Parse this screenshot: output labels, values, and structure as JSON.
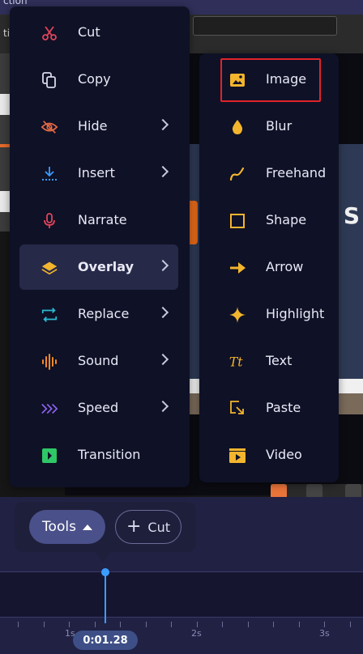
{
  "header": {
    "title_fragment": "ction"
  },
  "editor": {
    "strip_text": "ti"
  },
  "main_menu": {
    "items": [
      {
        "label": "Cut",
        "icon": "scissors-icon",
        "has_submenu": false,
        "color": "#e0445a"
      },
      {
        "label": "Copy",
        "icon": "copy-icon",
        "has_submenu": false,
        "color": "#d8d8e8"
      },
      {
        "label": "Hide",
        "icon": "eye-off-icon",
        "has_submenu": true,
        "color": "#e86a45"
      },
      {
        "label": "Insert",
        "icon": "insert-icon",
        "has_submenu": true,
        "color": "#3b9cff"
      },
      {
        "label": "Narrate",
        "icon": "microphone-icon",
        "has_submenu": false,
        "color": "#e0445a"
      },
      {
        "label": "Overlay",
        "icon": "layers-icon",
        "has_submenu": true,
        "active": true,
        "color": "#f3b52d"
      },
      {
        "label": "Replace",
        "icon": "replace-icon",
        "has_submenu": true,
        "color": "#2bbcd4"
      },
      {
        "label": "Sound",
        "icon": "sound-wave-icon",
        "has_submenu": true,
        "color": "#f08a2a"
      },
      {
        "label": "Speed",
        "icon": "speed-icon",
        "has_submenu": true,
        "color": "#8d63f0"
      },
      {
        "label": "Transition",
        "icon": "transition-icon",
        "has_submenu": false,
        "color": "#2ec866"
      }
    ]
  },
  "overlay_submenu": {
    "items": [
      {
        "label": "Image",
        "icon": "image-icon",
        "highlighted": true
      },
      {
        "label": "Blur",
        "icon": "drop-icon"
      },
      {
        "label": "Freehand",
        "icon": "freehand-icon"
      },
      {
        "label": "Shape",
        "icon": "square-icon"
      },
      {
        "label": "Arrow",
        "icon": "arrow-icon"
      },
      {
        "label": "Highlight",
        "icon": "sparkle-icon"
      },
      {
        "label": "Text",
        "icon": "text-icon"
      },
      {
        "label": "Paste",
        "icon": "paste-icon"
      },
      {
        "label": "Video",
        "icon": "video-icon"
      }
    ],
    "icon_color": "#f3b52d"
  },
  "toolbar": {
    "tools_label": "Tools",
    "cut_label": "Cut"
  },
  "timeline": {
    "tick_labels": [
      "1s",
      "2s",
      "3s"
    ],
    "current_time": "0:01.28"
  },
  "colors": {
    "highlight_border": "#e0242a",
    "playhead": "#3b9cff"
  }
}
